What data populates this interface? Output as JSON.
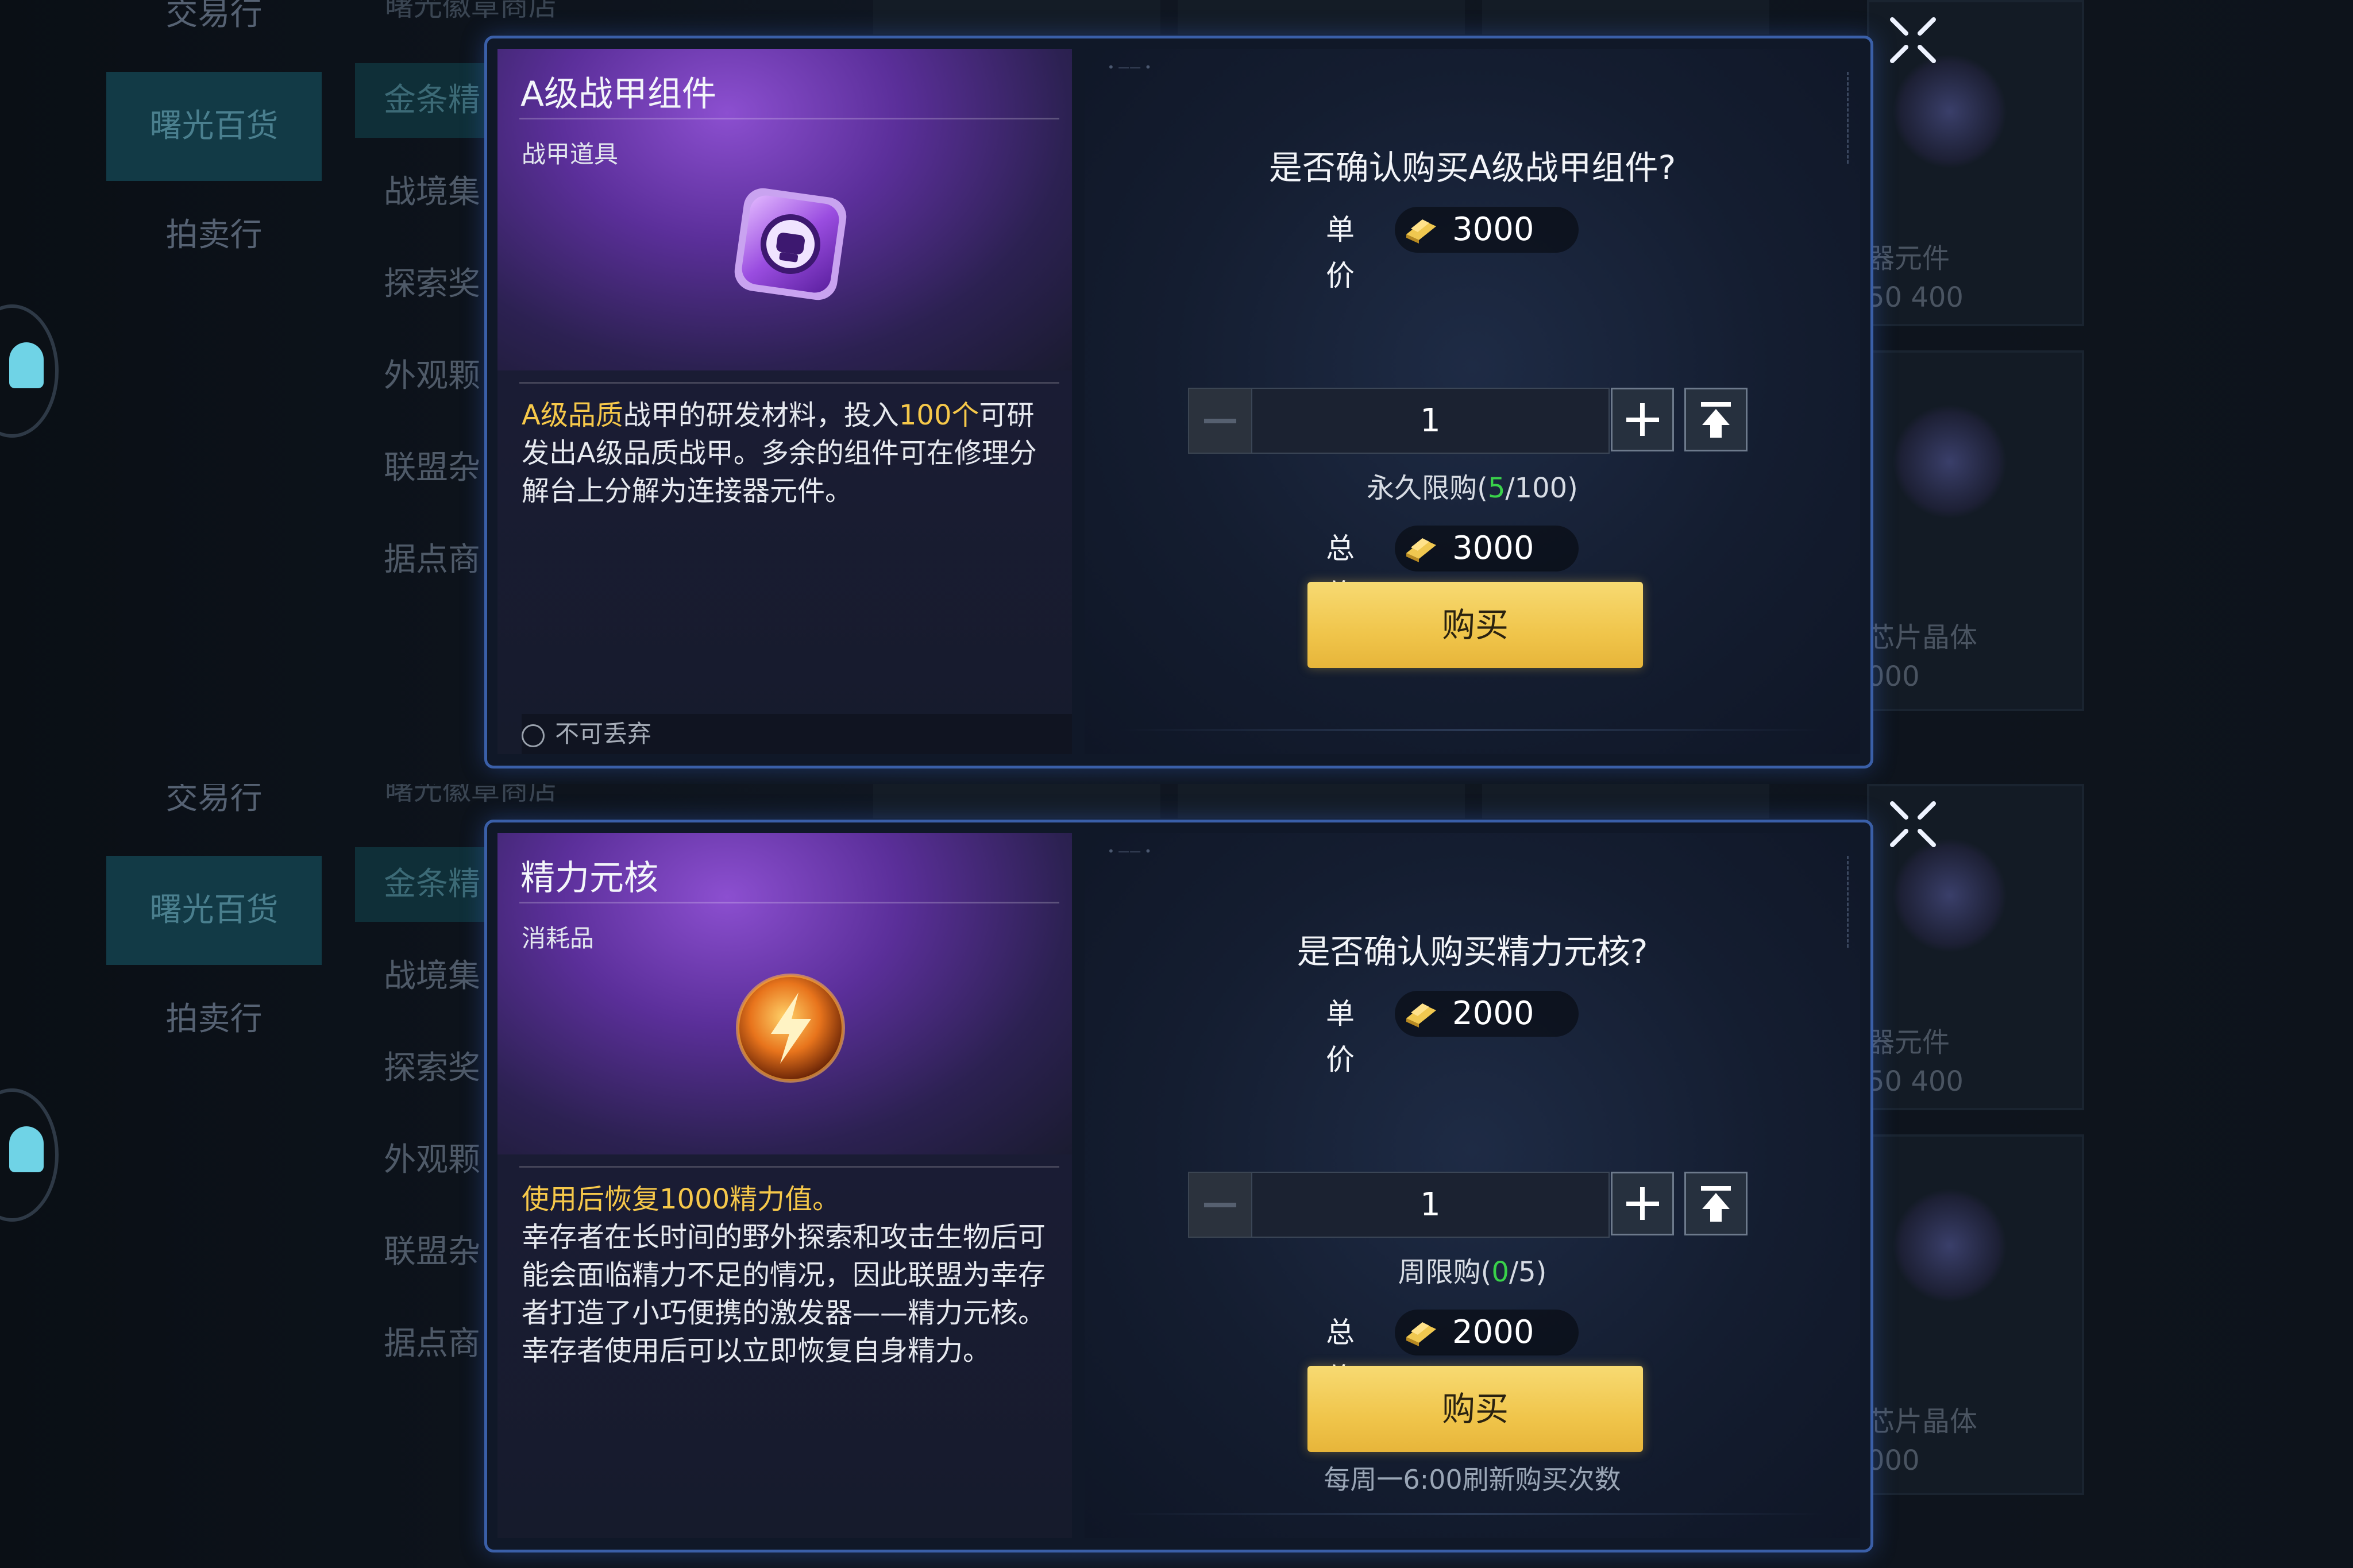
{
  "background": {
    "nav_items": [
      "交易行",
      "曙光百货",
      "拍卖行"
    ],
    "active_nav": "曙光百货",
    "shop_name": "曙光徽章商店",
    "categories": [
      "金条精",
      "战境集",
      "探索奖",
      "外观颗",
      "联盟杂",
      "据点商"
    ],
    "side_card_texts": [
      "器元件",
      "50 400",
      "芯片晶体",
      "000"
    ]
  },
  "dialogs": [
    {
      "item_title": "A级战甲组件",
      "item_type": "战甲道具",
      "icon": "armor-component-icon",
      "desc_highlight_1": "A级品质",
      "desc_text_1": "战甲的研发材料，投入",
      "desc_highlight_2": "100个",
      "desc_text_2": "可研发出A级品质战甲。多余的组件可在修理分解台上分解为连接器元件。",
      "no_drop": "不可丢弃",
      "confirm_text": "是否确认购买A级战甲组件?",
      "unit_price_label": "单价",
      "unit_price": "3000",
      "quantity": "1",
      "limit_prefix": "永久限购(",
      "limit_used": "5",
      "limit_suffix": "/100)",
      "total_label": "总价",
      "total_price": "3000",
      "buy_label": "购买"
    },
    {
      "item_title": "精力元核",
      "item_type": "消耗品",
      "icon": "energy-core-icon",
      "desc_highlight_1": "使用后恢复1000精力值。",
      "desc_text_1": "幸存者在长时间的野外探索和攻击生物后可能会面临精力不足的情况，因此联盟为幸存者打造了小巧便携的激发器——精力元核。幸存者使用后可以立即恢复自身精力。",
      "confirm_text": "是否确认购买精力元核?",
      "unit_price_label": "单价",
      "unit_price": "2000",
      "quantity": "1",
      "limit_prefix": "周限购(",
      "limit_used": "0",
      "limit_suffix": "/5)",
      "total_label": "总价",
      "total_price": "2000",
      "buy_label": "购买",
      "refresh_note": "每周一6:00刷新购买次数"
    }
  ],
  "colors": {
    "highlight": "#f6c84a",
    "limit_green": "#39d14a",
    "buy_button": "#f0c54b",
    "dialog_border": "#3a5fa8"
  }
}
